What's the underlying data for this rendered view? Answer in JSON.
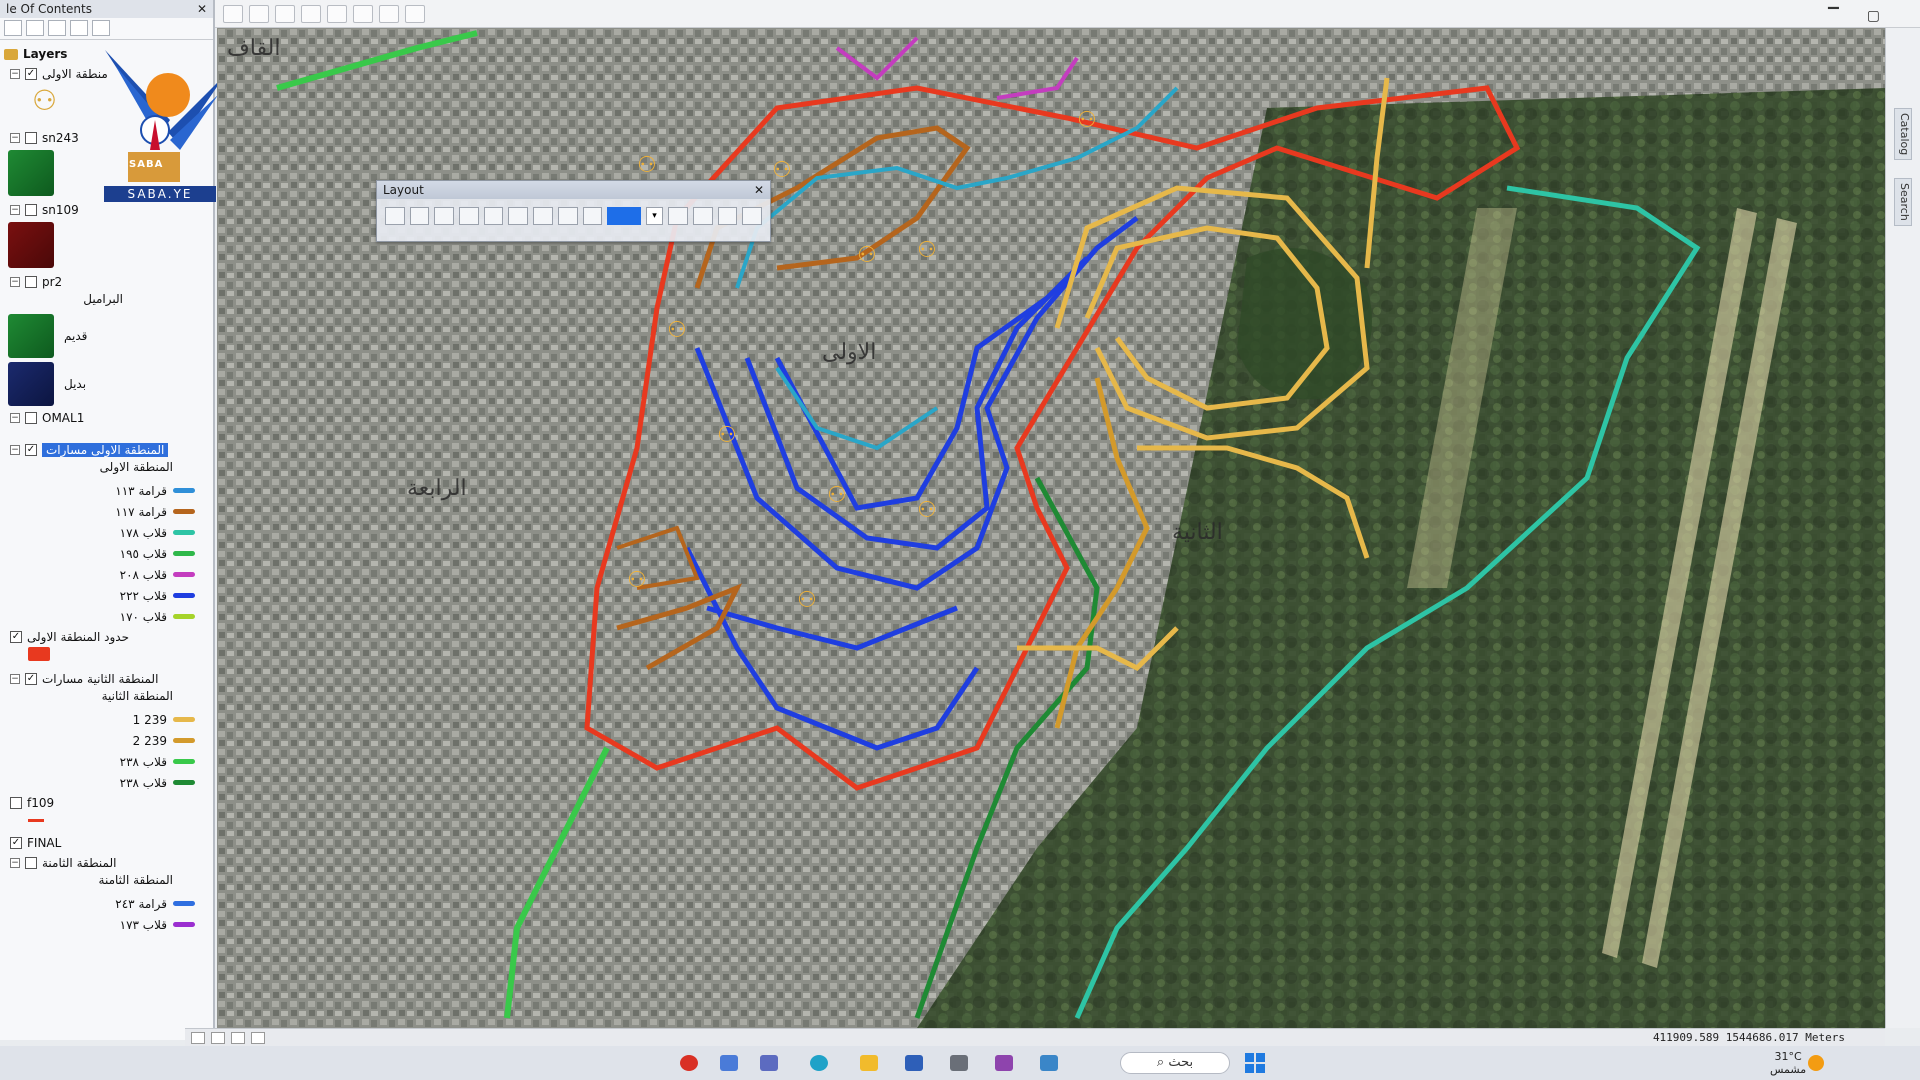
{
  "toc": {
    "title": "le Of Contents",
    "layers_label": "Layers",
    "rows": {
      "zone1_group": "منطقة الاولى",
      "sn243": "sn243",
      "sn109": "sn109",
      "pr2": "pr2",
      "pr2_sub": "البراميل",
      "qadeem": "قديم",
      "badeel": "بديل",
      "omal1": "OMAL1",
      "zone1_paths": "المنطقة الاولى مسارات",
      "zone1_paths_sub": "المنطقة الاولى",
      "zone1_border": "حدود المنطقة الاولى",
      "zone2_paths": "المنطقة الثانية مسارات",
      "zone2_paths_sub": "المنطقة الثانية",
      "f109": "f109",
      "final": "FINAL",
      "zone8": "المنطقة الثامنة",
      "zone8_sub": "المنطقة الثامنة"
    },
    "zone1_symbols": [
      {
        "label": "قرامة ١١٣",
        "color": "#2f8fd8"
      },
      {
        "label": "قرامة ١١٧",
        "color": "#b5651d"
      },
      {
        "label": "قلاب ١٧٨",
        "color": "#2ec4a5"
      },
      {
        "label": "قلاب ١٩٥",
        "color": "#2fb84a"
      },
      {
        "label": "قلاب ٢٠٨",
        "color": "#c43dbf"
      },
      {
        "label": "قلاب ٢٢٢",
        "color": "#1f3ee0"
      },
      {
        "label": "قلاب ١٧٠",
        "color": "#a6d42a"
      }
    ],
    "zone2_symbols": [
      {
        "label": "239 1",
        "color": "#e6b84a"
      },
      {
        "label": "239 2",
        "color": "#d39a2b"
      },
      {
        "label": "قلاب ٢٣٨",
        "color": "#39c94a"
      },
      {
        "label": "قلاب ٢٣٨",
        "color": "#1f8a34"
      }
    ],
    "zone8_symbols": [
      {
        "label": "قرامة ٢٤٣",
        "color": "#2f6fe0"
      },
      {
        "label": "قلاب ١٧٣",
        "color": "#9b2fd0"
      }
    ]
  },
  "logo": {
    "caption": "SABA.YE",
    "badge": "SABA"
  },
  "layout_toolbar": {
    "title": "Layout"
  },
  "map": {
    "labels": {
      "first": "الاولى",
      "second": "الثانية",
      "fourth": "الرابعة",
      "north": "القاف"
    }
  },
  "dock": {
    "tabs": [
      "Catalog",
      "Search"
    ]
  },
  "status": {
    "coords": "411909.589  1544686.017 Meters"
  },
  "taskbar": {
    "search_label": "بحث",
    "weather_temp": "31°C",
    "weather_desc": "مشمس"
  },
  "colors": {
    "zone_red": "#e8391f",
    "zone_blue": "#1f3ee0",
    "zone_brown": "#b5651d",
    "zone_teal": "#2ec4a5",
    "zone_gold": "#e6b84a",
    "zone_green": "#2fb84a",
    "zone_magenta": "#c43dbf",
    "zone_cyan": "#2aa6c8"
  }
}
